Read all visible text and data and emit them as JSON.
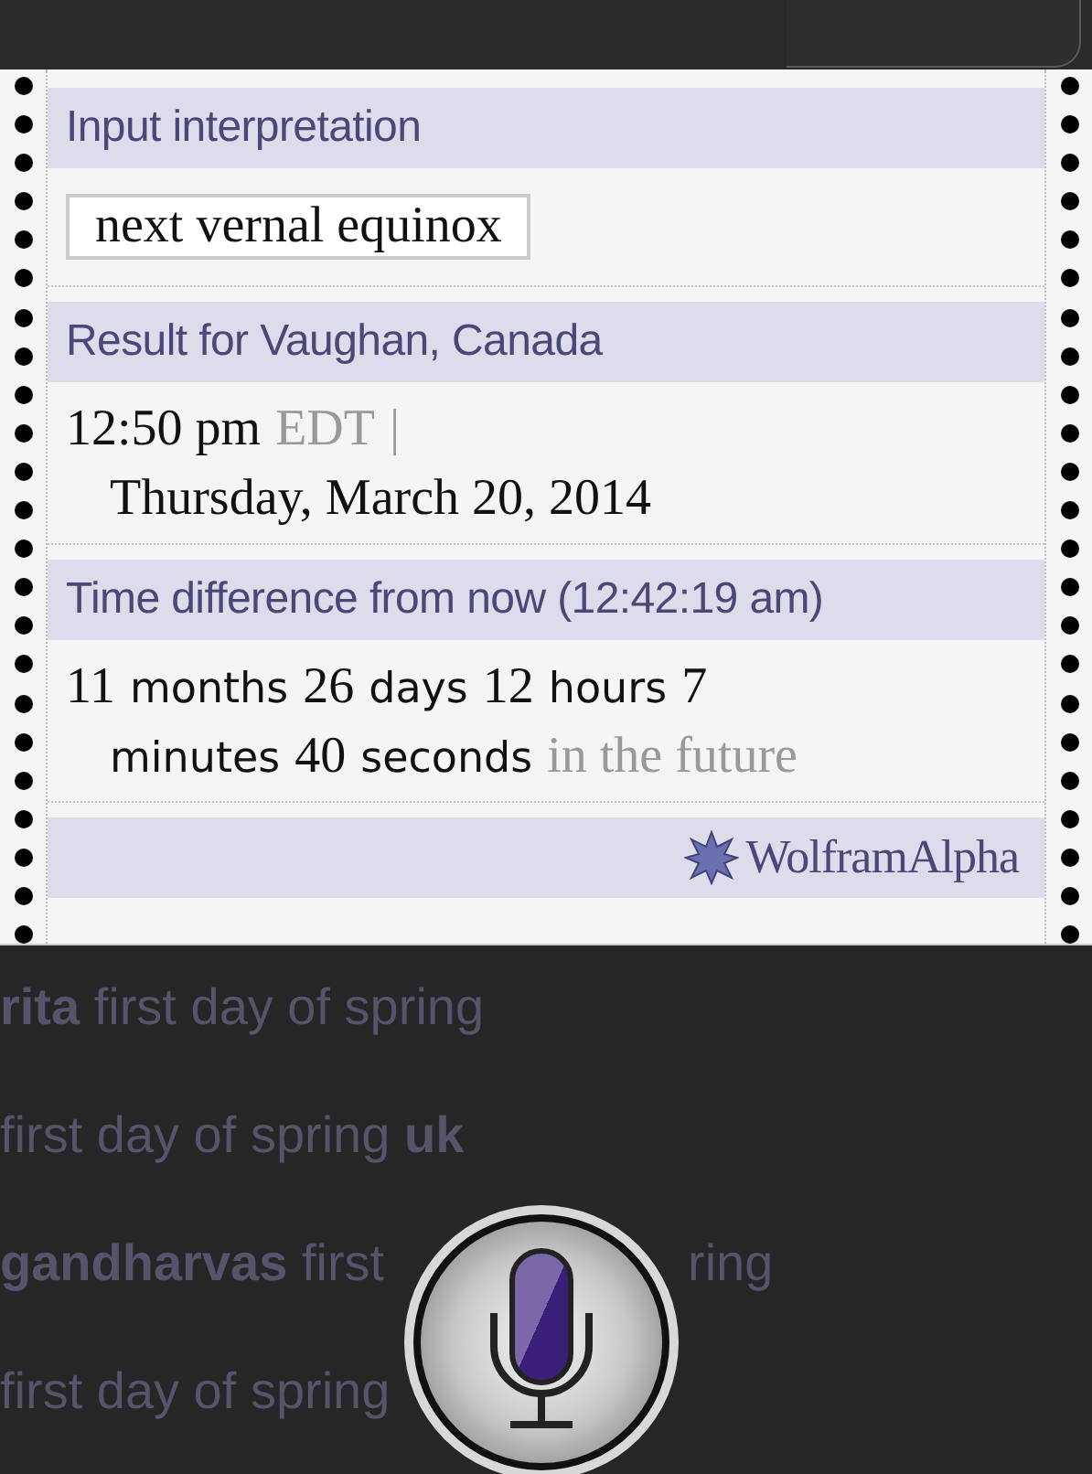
{
  "result_card": {
    "pods": [
      {
        "title": "Input interpretation",
        "kind": "input",
        "lines": [
          [
            {
              "text": "next vernal equinox",
              "kind": "number"
            }
          ]
        ]
      },
      {
        "title": "Result for Vaughan, Canada",
        "kind": "result",
        "lines": [
          [
            {
              "text": "12:50 pm",
              "kind": "number"
            },
            {
              "text": "EDT",
              "kind": "note"
            },
            {
              "text": "|",
              "kind": "note"
            }
          ],
          [
            {
              "text": "Thursday, March 20, 2014",
              "kind": "number"
            }
          ]
        ]
      },
      {
        "title": "Time difference from now (12:42:19 am)",
        "kind": "result",
        "lines": [
          [
            {
              "text": "11",
              "kind": "number"
            },
            {
              "text": "months",
              "kind": "unit"
            },
            {
              "text": "26",
              "kind": "number"
            },
            {
              "text": "days",
              "kind": "unit"
            },
            {
              "text": "12",
              "kind": "number"
            },
            {
              "text": "hours",
              "kind": "unit"
            },
            {
              "text": "7",
              "kind": "number"
            }
          ],
          [
            {
              "text": "minutes",
              "kind": "unit"
            },
            {
              "text": "40",
              "kind": "number"
            },
            {
              "text": "seconds",
              "kind": "unit"
            },
            {
              "text": "in the future",
              "kind": "note"
            }
          ]
        ]
      }
    ],
    "footer": {
      "brand": "WolframAlpha"
    }
  },
  "suggestions": [
    {
      "parts": [
        "**rita** first day of spring"
      ]
    },
    {
      "parts": [
        "first day of spring **uk**"
      ]
    },
    {
      "parts": [
        "**gandharvas** first",
        "ring"
      ]
    },
    {
      "parts": [
        "first day of spring"
      ]
    }
  ]
}
